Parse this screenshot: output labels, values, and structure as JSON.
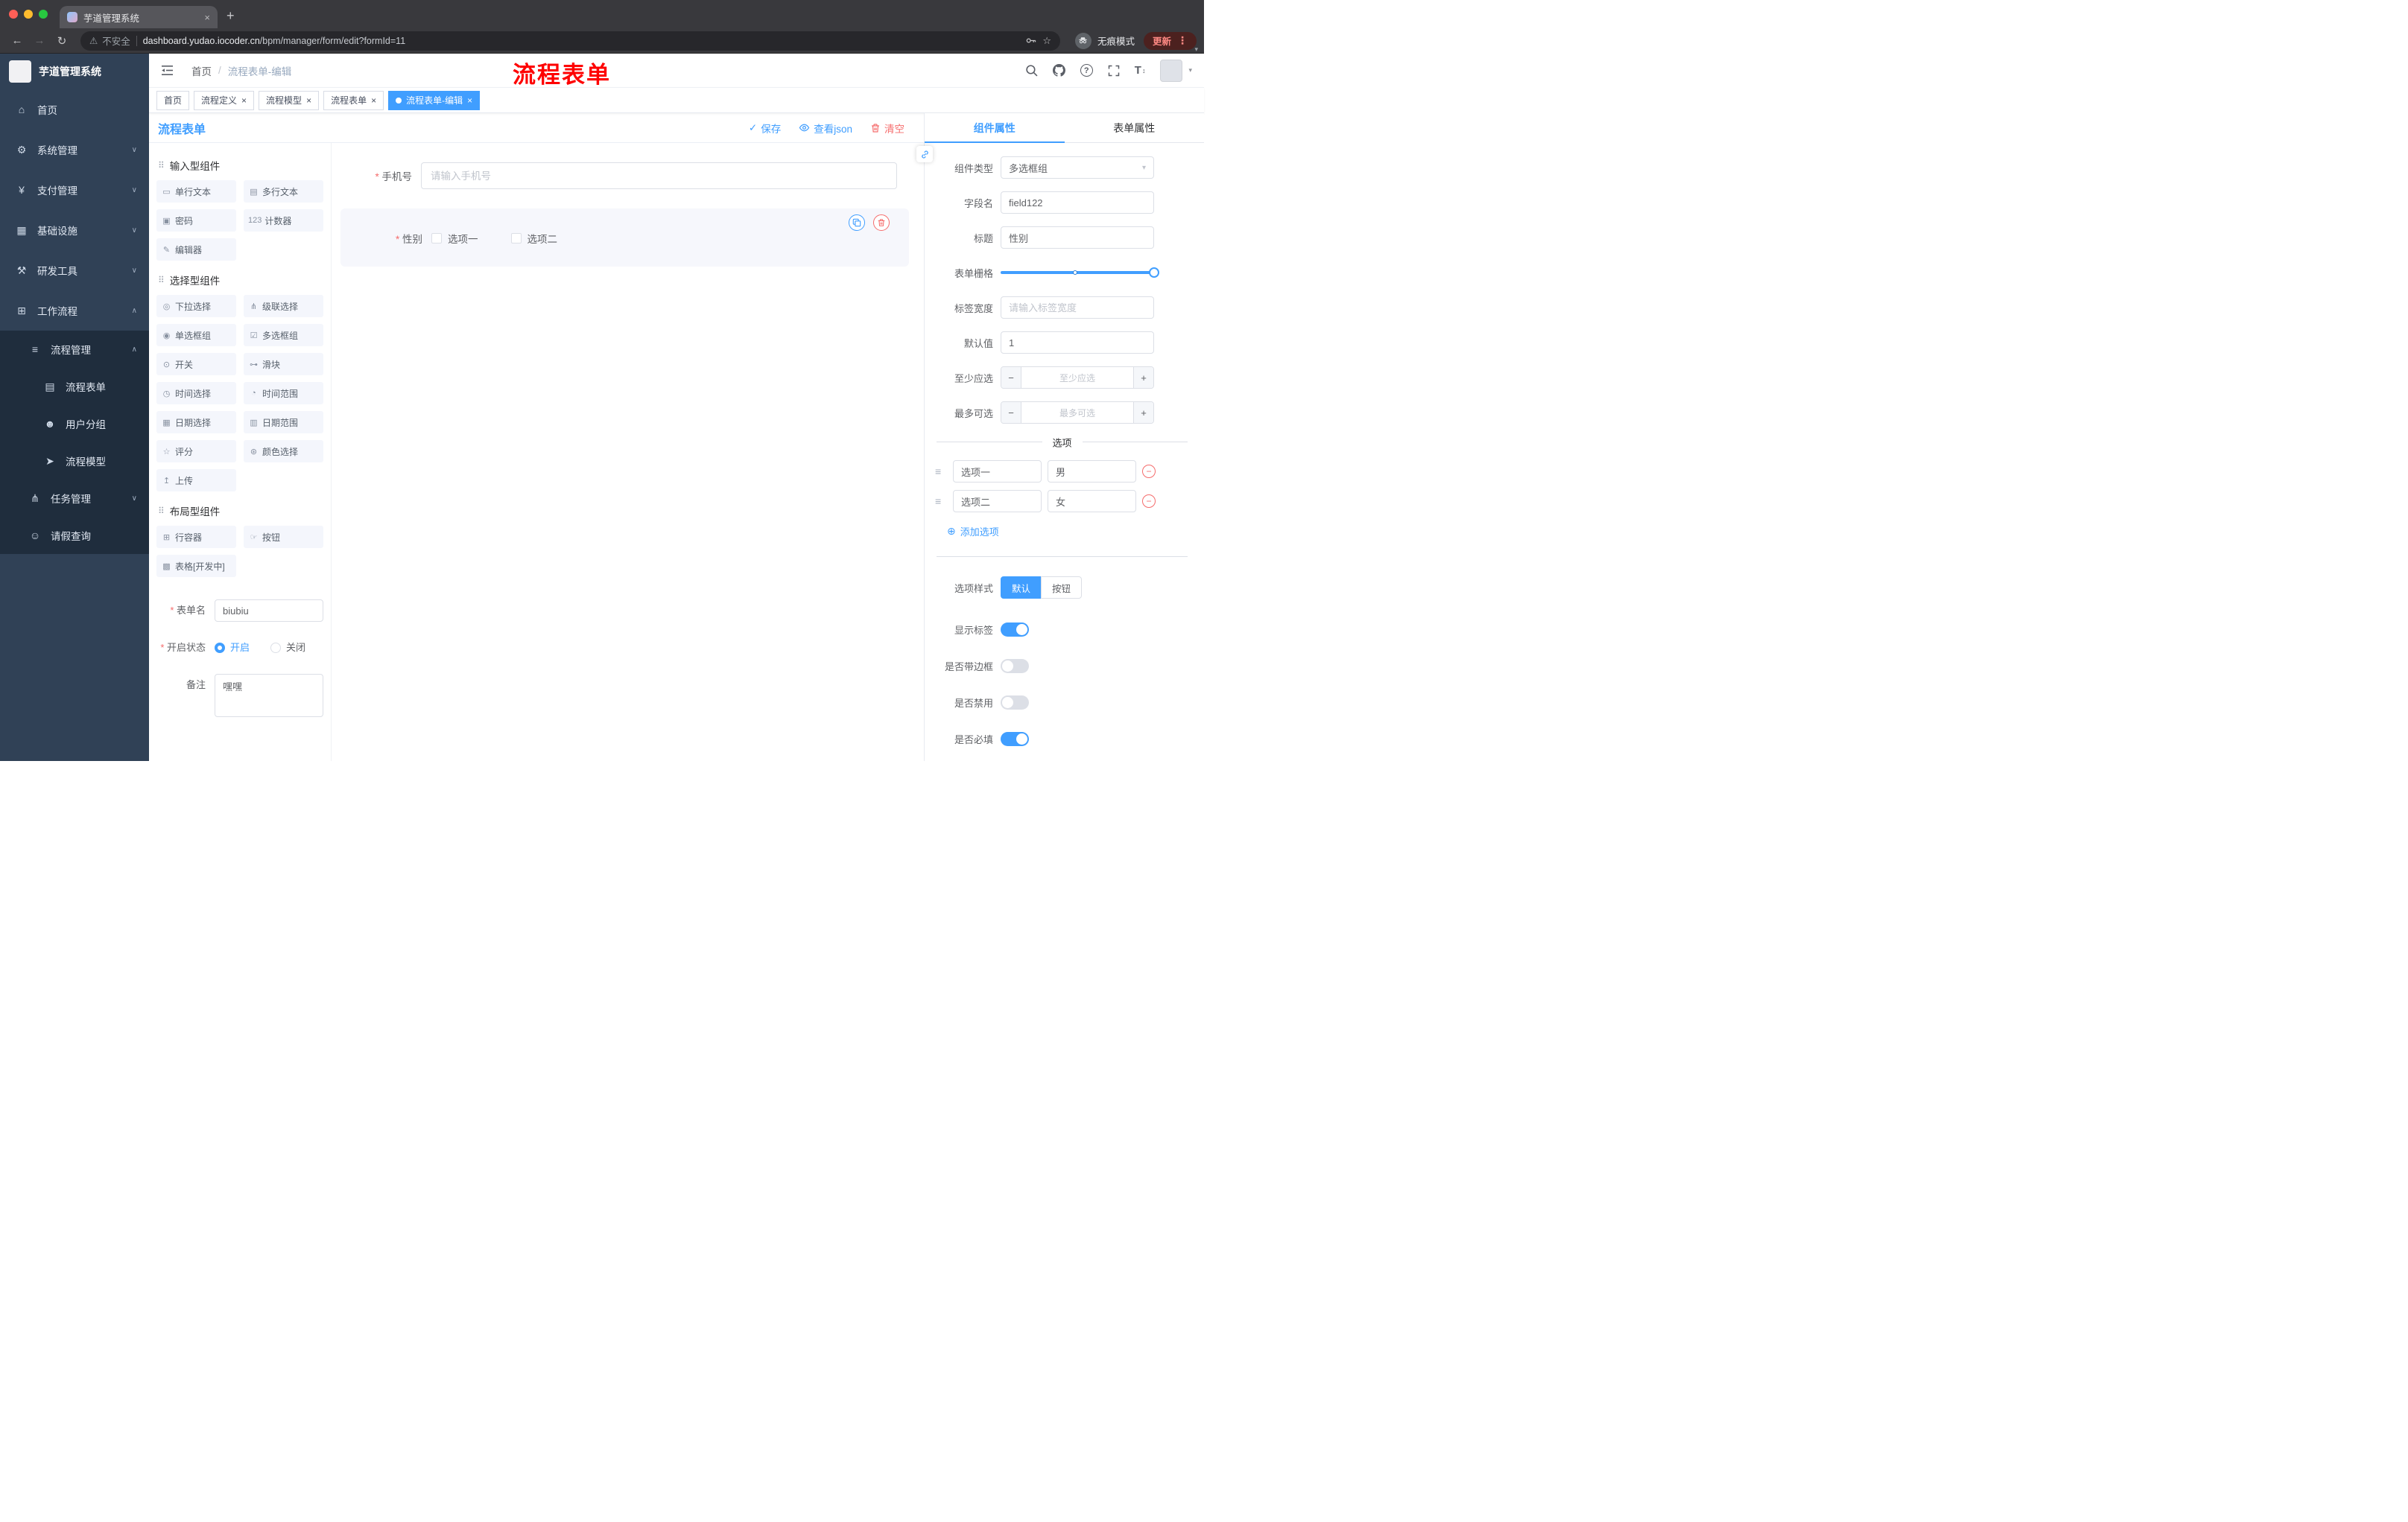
{
  "colors": {
    "primary": "#409eff",
    "danger": "#f56c6c",
    "sidebar_bg": "#304156",
    "sidebar_sub_bg": "#1f2d3d",
    "annotation_red": "#fe0000",
    "tag_active_bg": "#409eff"
  },
  "browser": {
    "tab_title": "芋道管理系统",
    "security_label": "不安全",
    "url_host": "dashboard.yudao.iocoder.cn",
    "url_path": "/bpm/manager/form/edit?formId=11",
    "incognito_label": "无痕模式",
    "update_label": "更新",
    "toolbar_icons": [
      "back-icon",
      "forward-icon",
      "reload-icon",
      "warning-icon",
      "key-icon",
      "star-icon",
      "incognito-icon",
      "kebab-menu-icon",
      "caret-down-icon"
    ]
  },
  "sidebar": {
    "brand": "芋道管理系统",
    "items": [
      {
        "icon": "⌂",
        "label": "首页",
        "arrow": "",
        "cls": ""
      },
      {
        "icon": "⚙",
        "label": "系统管理",
        "arrow": "∨",
        "cls": ""
      },
      {
        "icon": "¥",
        "label": "支付管理",
        "arrow": "∨",
        "cls": ""
      },
      {
        "icon": "▦",
        "label": "基础设施",
        "arrow": "∨",
        "cls": ""
      },
      {
        "icon": "⚒",
        "label": "研发工具",
        "arrow": "∨",
        "cls": ""
      },
      {
        "icon": "⊞",
        "label": "工作流程",
        "arrow": "∧",
        "cls": "open"
      },
      {
        "icon": "≡",
        "label": "流程管理",
        "arrow": "∧",
        "cls": "sub1"
      },
      {
        "icon": "▤",
        "label": "流程表单",
        "arrow": "",
        "cls": "sub2 active"
      },
      {
        "icon": "☻",
        "label": "用户分组",
        "arrow": "",
        "cls": "sub2"
      },
      {
        "icon": "➤",
        "label": "流程模型",
        "arrow": "",
        "cls": "sub2"
      },
      {
        "icon": "⋔",
        "label": "任务管理",
        "arrow": "∨",
        "cls": "sub1"
      },
      {
        "icon": "☺",
        "label": "请假查询",
        "arrow": "",
        "cls": "sub1"
      }
    ]
  },
  "header": {
    "breadcrumb_home": "首页",
    "breadcrumb_separator": "/",
    "breadcrumb_current": "流程表单-编辑",
    "overlay_title": "流程表单",
    "right_icons": [
      "search-icon",
      "github-icon",
      "question-icon",
      "fullscreen-icon",
      "font-size-icon",
      "avatar",
      "caret-down-icon"
    ]
  },
  "tags": [
    {
      "label": "首页",
      "closable": false,
      "active": false
    },
    {
      "label": "流程定义",
      "closable": true,
      "active": false
    },
    {
      "label": "流程模型",
      "closable": true,
      "active": false
    },
    {
      "label": "流程表单",
      "closable": true,
      "active": false
    },
    {
      "label": "流程表单-编辑",
      "closable": true,
      "active": true
    }
  ],
  "designer": {
    "title": "流程表单",
    "actions": {
      "save": "保存",
      "view_json": "查看json",
      "clear": "清空"
    },
    "palette": {
      "input_title": "输入型组件",
      "input_items": [
        {
          "icon": "▭",
          "label": "单行文本"
        },
        {
          "icon": "▤",
          "label": "多行文本"
        },
        {
          "icon": "▣",
          "label": "密码"
        },
        {
          "icon": "123",
          "label": "计数器"
        },
        {
          "icon": "✎",
          "label": "编辑器"
        }
      ],
      "select_title": "选择型组件",
      "select_items": [
        {
          "icon": "◎",
          "label": "下拉选择"
        },
        {
          "icon": "⋔",
          "label": "级联选择"
        },
        {
          "icon": "◉",
          "label": "单选框组"
        },
        {
          "icon": "☑",
          "label": "多选框组"
        },
        {
          "icon": "⊙",
          "label": "开关"
        },
        {
          "icon": "⊶",
          "label": "滑块"
        },
        {
          "icon": "◷",
          "label": "时间选择"
        },
        {
          "icon": "◔",
          "label": "时间范围"
        },
        {
          "icon": "▦",
          "label": "日期选择"
        },
        {
          "icon": "▥",
          "label": "日期范围"
        },
        {
          "icon": "☆",
          "label": "评分"
        },
        {
          "icon": "⊛",
          "label": "颜色选择"
        },
        {
          "icon": "↥",
          "label": "上传"
        }
      ],
      "layout_title": "布局型组件",
      "layout_items": [
        {
          "icon": "⊞",
          "label": "行容器"
        },
        {
          "icon": "☞",
          "label": "按钮"
        },
        {
          "icon": "▩",
          "label": "表格[开发中]"
        }
      ]
    },
    "base_form": {
      "name_label": "表单名",
      "name_value": "biubiu",
      "status_label": "开启状态",
      "status_on": "开启",
      "status_off": "关闭",
      "remark_label": "备注",
      "remark_value": "嘿嘿"
    },
    "canvas": {
      "phone_label": "手机号",
      "phone_placeholder": "请输入手机号",
      "gender_label": "性别",
      "gender_options": [
        "选项一",
        "选项二"
      ]
    }
  },
  "props": {
    "tab_component": "组件属性",
    "tab_form": "表单属性",
    "type_label": "组件类型",
    "type_value": "多选框组",
    "field_label": "字段名",
    "field_value": "field122",
    "title_label": "标题",
    "title_value": "性别",
    "grid_label": "表单栅格",
    "label_width_label": "标签宽度",
    "label_width_placeholder": "请输入标签宽度",
    "default_label": "默认值",
    "default_value": "1",
    "min_label": "至少应选",
    "min_placeholder": "至少应选",
    "max_label": "最多可选",
    "max_placeholder": "最多可选",
    "options_title": "选项",
    "options": [
      {
        "label": "选项一",
        "value": "男"
      },
      {
        "label": "选项二",
        "value": "女"
      }
    ],
    "add_option": "添加选项",
    "style_label": "选项样式",
    "style_default": "默认",
    "style_button": "按钮",
    "toggles": [
      {
        "label": "显示标签",
        "on": true
      },
      {
        "label": "是否带边框",
        "on": false
      },
      {
        "label": "是否禁用",
        "on": false
      },
      {
        "label": "是否必填",
        "on": true
      }
    ]
  }
}
